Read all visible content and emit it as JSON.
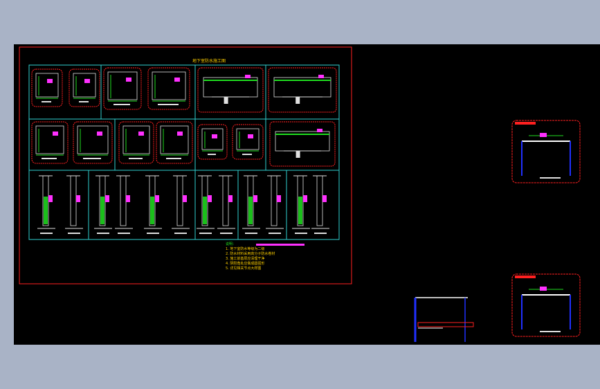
{
  "canvas": {
    "background": "#000000",
    "app_background": "#a9b3c6"
  },
  "colors": {
    "frame": "#ff2020",
    "grid": "#2fd0d0",
    "wall": "#e0e0e0",
    "green": "#20e020",
    "magenta": "#ff30ff",
    "yellow": "#ffd000",
    "blue": "#2030ff",
    "white": "#ffffff",
    "cyan": "#00e0ff"
  },
  "sheet_title": "地下室防水施工图",
  "notes": [
    "说明：",
    "1. 地下室防水等级为二级",
    "2. 防水材料采用高分子防水卷材",
    "3. 施工前基层应清理干净",
    "4. 阴阳角处应做成圆弧形",
    "5. 详见相关节点大样图"
  ]
}
